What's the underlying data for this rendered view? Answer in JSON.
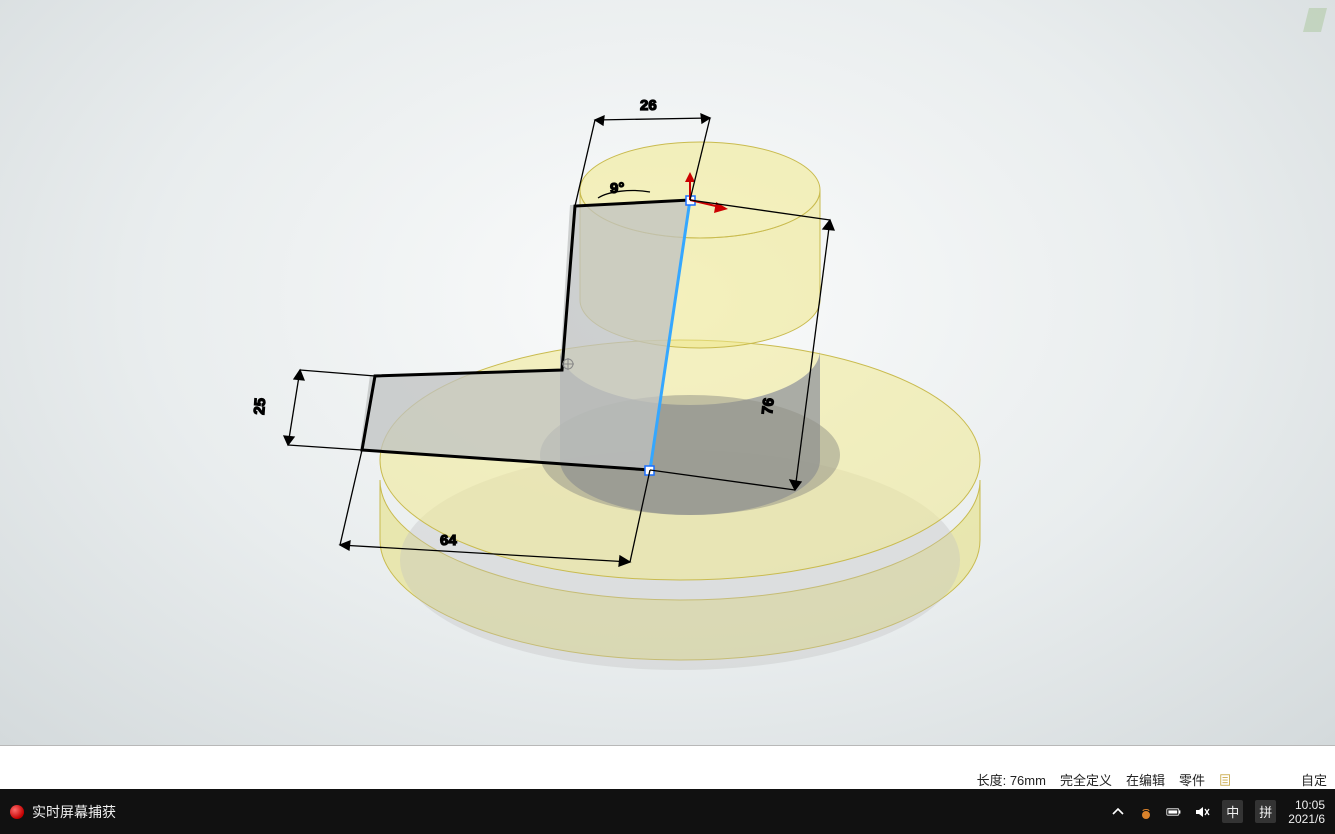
{
  "dimensions": {
    "top_horizontal": "26",
    "angle": "9°",
    "left_vertical": "25",
    "far_vertical": "76",
    "bottom_horizontal": "64"
  },
  "status": {
    "length_label": "长度:",
    "length_value": "76mm",
    "definition": "完全定义",
    "mode_editing": "在编辑",
    "mode_part": "零件",
    "auto_label": "自定"
  },
  "taskbar": {
    "recording_label": "实时屏幕捕获",
    "ime_lang": "中",
    "ime_mode": "拼",
    "time": "10:05",
    "date": "2021/6"
  }
}
